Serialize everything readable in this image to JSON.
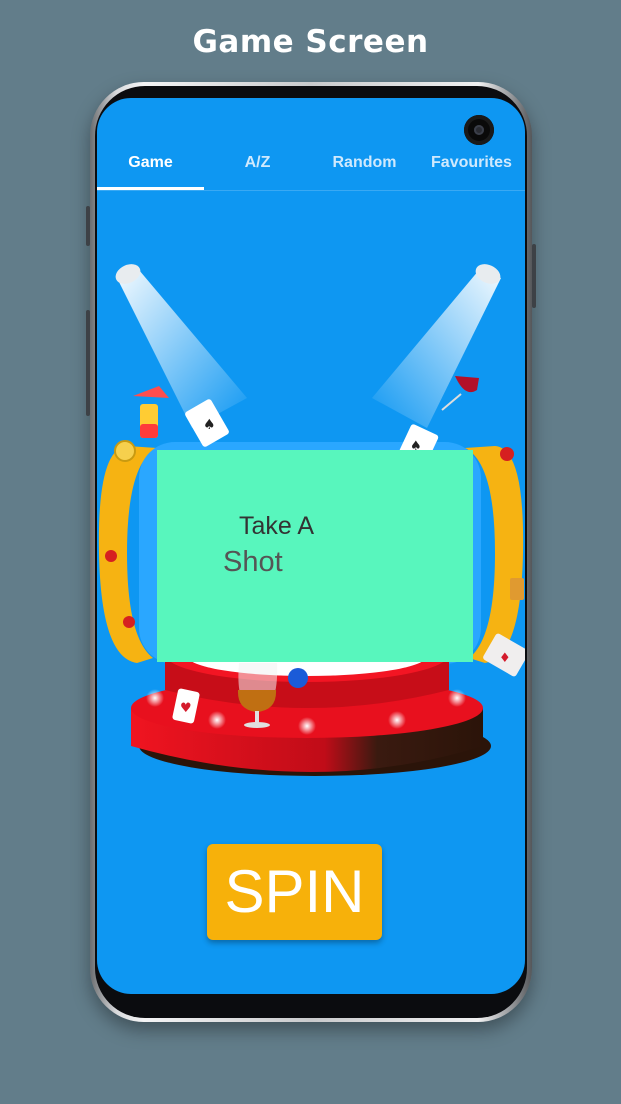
{
  "page": {
    "title": "Game Screen"
  },
  "tabs": [
    {
      "label": "Game",
      "active": true
    },
    {
      "label": "A/Z",
      "active": false
    },
    {
      "label": "Random",
      "active": false
    },
    {
      "label": "Favourites",
      "active": false
    }
  ],
  "result": {
    "line1": "Take A",
    "line2": "Shot"
  },
  "spin_button": {
    "label": "SPIN"
  },
  "colors": {
    "background": "#627d8a",
    "screen": "#0e97f2",
    "result_box": "#58f6bd",
    "spin_button": "#f7b10a",
    "wheel_rim": "#f6b312",
    "platform_red": "#e8101e"
  },
  "icons": [
    "spotlight-icon",
    "cocktail-icon",
    "wine-glass-icon",
    "playing-card-icon",
    "poker-chip-icon",
    "brandy-glass-icon",
    "whiskey-glass-icon"
  ]
}
